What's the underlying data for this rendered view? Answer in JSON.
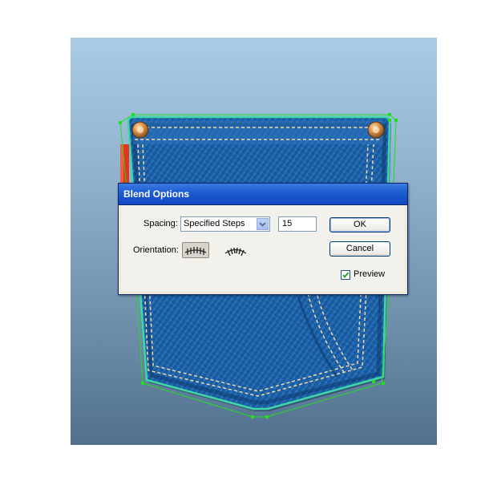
{
  "dialog": {
    "title": "Blend Options",
    "spacing_label": "Spacing:",
    "spacing_value": "Specified Steps",
    "steps_value": "15",
    "orientation_label": "Orientation:",
    "ok_label": "OK",
    "cancel_label": "Cancel",
    "preview_label": "Preview",
    "preview_checked": true
  },
  "icons": {
    "dropdown": "chevron-down-icon",
    "align_to_page": "align-to-page-icon",
    "align_to_path": "align-to-path-icon",
    "checkmark": "checkmark-icon"
  },
  "colors": {
    "canvas_top": "#a9cce4",
    "canvas_bottom": "#52708e",
    "denim": "#1d63a8",
    "selection": "#22dd22",
    "title_bar": "#1c5ad0"
  }
}
